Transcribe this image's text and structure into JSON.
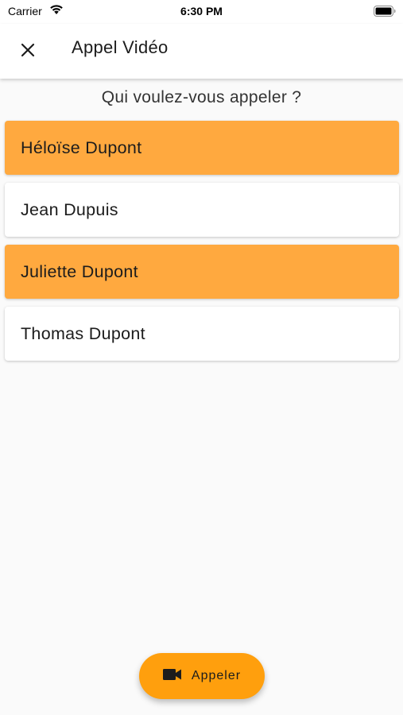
{
  "status_bar": {
    "carrier": "Carrier",
    "time": "6:30 PM",
    "wifi_icon": "wifi-icon",
    "battery_icon": "battery-icon"
  },
  "app_bar": {
    "title": "Appel Vidéo",
    "close_icon": "close-icon"
  },
  "prompt": "Qui voulez-vous appeler ?",
  "contacts": [
    {
      "name": "Héloïse Dupont",
      "selected": true
    },
    {
      "name": "Jean Dupuis",
      "selected": false
    },
    {
      "name": "Juliette Dupont",
      "selected": true
    },
    {
      "name": "Thomas Dupont",
      "selected": false
    }
  ],
  "call_button": {
    "label": "Appeler",
    "icon": "video-camera-icon"
  },
  "colors": {
    "selected": "#ffa93f",
    "fab": "#ff9f0d",
    "background": "#fafafa"
  }
}
